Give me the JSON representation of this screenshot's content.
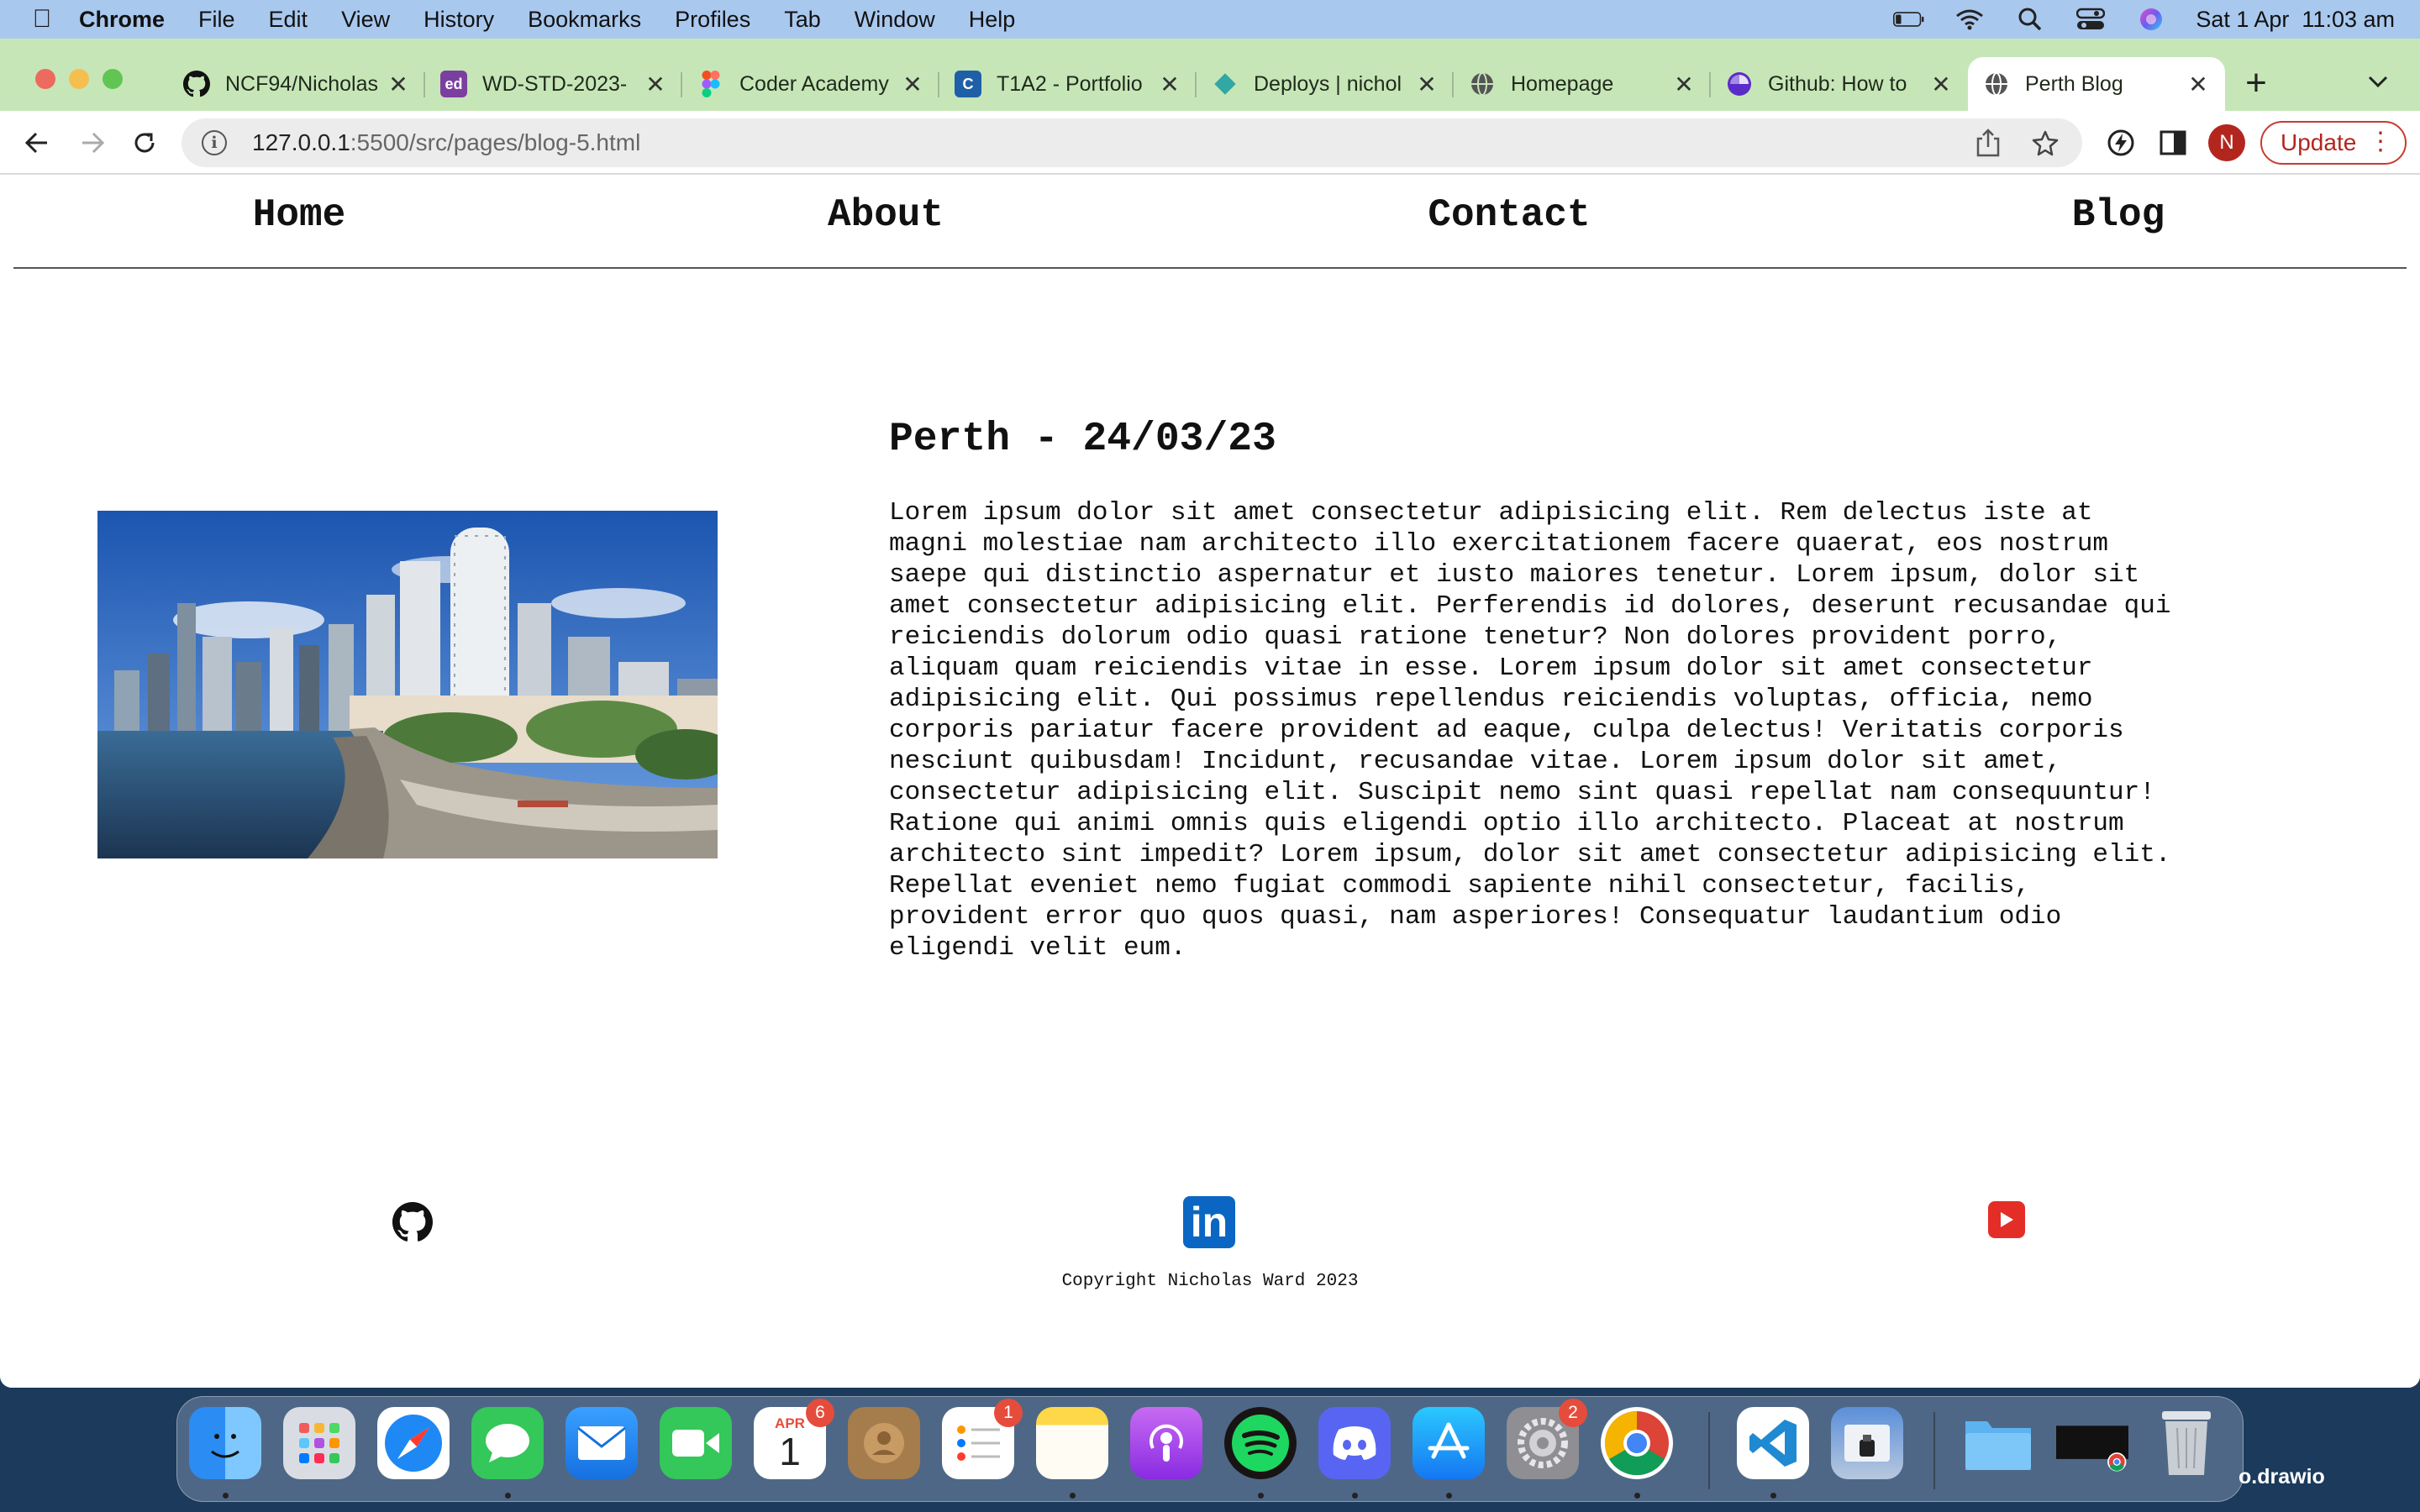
{
  "menubar": {
    "app": "Chrome",
    "items": [
      "File",
      "Edit",
      "View",
      "History",
      "Bookmarks",
      "Profiles",
      "Tab",
      "Window",
      "Help"
    ],
    "clock": "Sat 1 Apr  11:03 am"
  },
  "tabs": [
    {
      "label": "NCF94/Nicholas",
      "icon": "github-icon"
    },
    {
      "label": "WD-STD-2023-",
      "icon": "ed-icon"
    },
    {
      "label": "Coder Academy",
      "icon": "figma-icon"
    },
    {
      "label": "T1A2 - Portfolio",
      "icon": "canvas-icon"
    },
    {
      "label": "Deploys | nichol",
      "icon": "netlify-icon"
    },
    {
      "label": "Homepage",
      "icon": "globe-icon"
    },
    {
      "label": "Github: How to",
      "icon": "pinwheel-icon"
    },
    {
      "label": "Perth Blog",
      "icon": "globe-icon"
    }
  ],
  "toolbar": {
    "url_host": "127.0.0.1",
    "url_rest": ":5500/src/pages/blog-5.html",
    "avatar_initial": "N",
    "update_label": "Update"
  },
  "site": {
    "nav": [
      "Home",
      "About",
      "Contact",
      "Blog"
    ],
    "post_title": "Perth - 24/03/23",
    "post_body": "Lorem ipsum dolor sit amet consectetur adipisicing elit. Rem delectus iste at magni molestiae nam architecto illo exercitationem facere quaerat, eos nostrum saepe qui distinctio aspernatur et iusto maiores tenetur. Lorem ipsum, dolor sit amet consectetur adipisicing elit. Perferendis id dolores, deserunt recusandae qui reiciendis dolorum odio quasi ratione tenetur? Non dolores provident porro, aliquam quam reiciendis vitae in esse. Lorem ipsum dolor sit amet consectetur adipisicing elit. Qui possimus repellendus reiciendis voluptas, officia, nemo corporis pariatur facere provident ad eaque, culpa delectus! Veritatis corporis nesciunt quibusdam! Incidunt, recusandae vitae. Lorem ipsum dolor sit amet, consectetur adipisicing elit. Suscipit nemo sint quasi repellat nam consequuntur! Ratione qui animi omnis quis eligendi optio illo architecto. Placeat at nostrum architecto sint impedit? Lorem ipsum, dolor sit amet consectetur adipisicing elit. Repellat eveniet nemo fugiat commodi sapiente nihil consectetur, facilis, provident error quo quos quasi, nam asperiores! Consequatur laudantium odio eligendi velit eum.",
    "footer_icons": [
      "github-icon",
      "linkedin-icon",
      "youtube-icon"
    ],
    "linkedin_text": "in",
    "copyright": "Copyright Nicholas Ward 2023"
  },
  "dock": {
    "calendar_month": "APR",
    "calendar_day": "1",
    "calendar_badge": "6",
    "reminders_badge": "1",
    "settings_badge": "2",
    "desktop_label": "o.drawio"
  },
  "colors": {
    "menubar": "#a9c8ee",
    "tabstrip": "#c7e6b8",
    "accent_red": "#b3261e",
    "linkedin": "#0a66c2",
    "youtube": "#e52d27"
  }
}
